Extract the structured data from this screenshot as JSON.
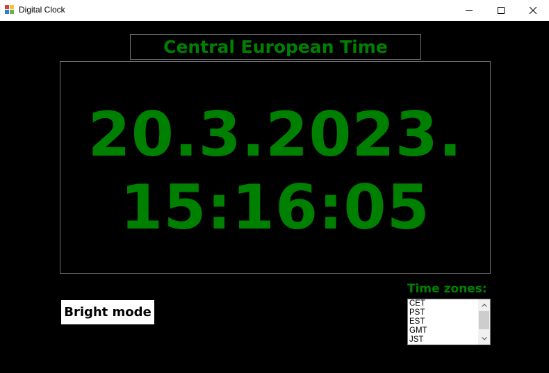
{
  "window": {
    "title": "Digital Clock",
    "controls": [
      "minimize",
      "maximize",
      "close"
    ]
  },
  "clock": {
    "timezone_title": "Central European Time",
    "date": "20.3.2023.",
    "time": "15:16:05",
    "text_color": "#008000",
    "background_color": "#000000"
  },
  "mode_button": {
    "label": "Bright mode"
  },
  "timezones": {
    "label": "Time zones:",
    "items": [
      "CET",
      "PST",
      "EST",
      "GMT",
      "JST"
    ]
  }
}
